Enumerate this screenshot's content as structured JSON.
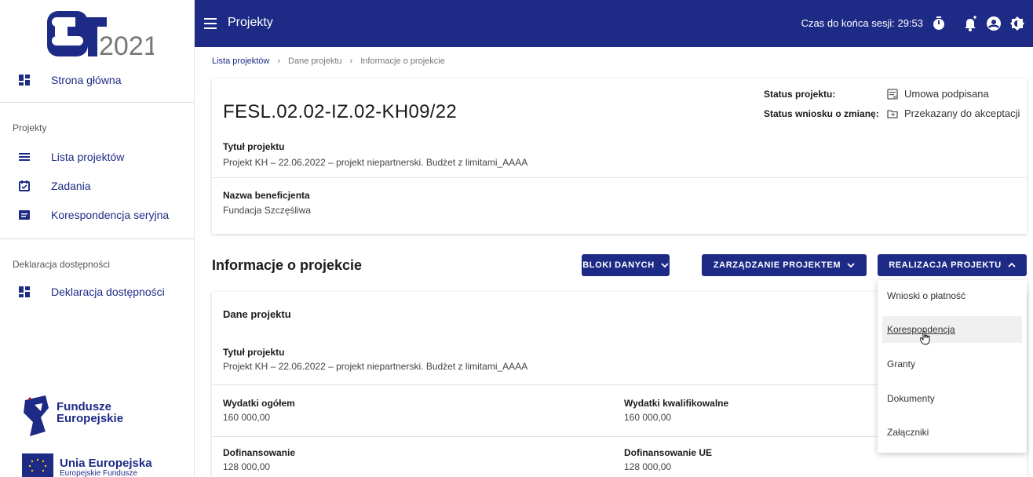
{
  "sidebar": {
    "logo_text": "2021",
    "home_label": "Strona główna",
    "section_projects": "Projekty",
    "items": [
      {
        "label": "Lista projektów"
      },
      {
        "label": "Zadania"
      },
      {
        "label": "Korespondencja seryjna"
      }
    ],
    "section_accessibility": "Deklaracja dostępności",
    "accessibility_item": "Deklaracja dostępności",
    "fe_line1": "Fundusze",
    "fe_line2": "Europejskie",
    "eu_title": "Unia Europejska",
    "eu_sub": "Europejskie Fundusze"
  },
  "topbar": {
    "title": "Projekty",
    "session_label": "Czas do końca sesji: 29:53",
    "icons": [
      "timer-icon",
      "notification-icon",
      "user-icon",
      "contrast-icon"
    ]
  },
  "breadcrumb": {
    "items": [
      "Lista projektów",
      "Dane projektu",
      "Informacje o projekcie"
    ]
  },
  "project": {
    "code": "FESL.02.02-IZ.02-KH09/22",
    "status_label": "Status projektu:",
    "status_value": "Umowa podpisana",
    "change_label": "Status wniosku o zmianę:",
    "change_value": "Przekazany do akceptacji",
    "title_label": "Tytuł projektu",
    "title_value": "Projekt KH – 22.06.2022 – projekt niepartnerski. Budżet z limitami_AAAA",
    "beneficiary_label": "Nazwa beneficjenta",
    "beneficiary_value": "Fundacja Szczęśliwa"
  },
  "section": {
    "title": "Informacje o projekcie",
    "btn_blocks": "BLOKI DANYCH",
    "btn_management": "ZARZĄDZANIE PROJEKTEM",
    "btn_realization": "REALIZACJA PROJEKTU"
  },
  "data_card": {
    "title": "Dane projektu",
    "title_label": "Tytuł projektu",
    "title_value": "Projekt KH – 22.06.2022 – projekt niepartnerski. Budżet z limitami_AAAA",
    "total_label": "Wydatki ogółem",
    "total_value": "160 000,00",
    "qualified_label": "Wydatki kwalifikowalne",
    "qualified_value": "160 000,00",
    "cofinancing_label": "Dofinansowanie",
    "cofinancing_value": "128 000,00",
    "eu_cofinancing_label": "Dofinansowanie UE",
    "eu_cofinancing_value": "128 000,00"
  },
  "dropdown": {
    "items": [
      {
        "label": "Wnioski o płatność"
      },
      {
        "label": "Korespondencja"
      },
      {
        "label": "Granty"
      },
      {
        "label": "Dokumenty"
      },
      {
        "label": "Załączniki"
      }
    ]
  },
  "colors": {
    "primary": "#1e2b86",
    "background": "#ffffff"
  }
}
